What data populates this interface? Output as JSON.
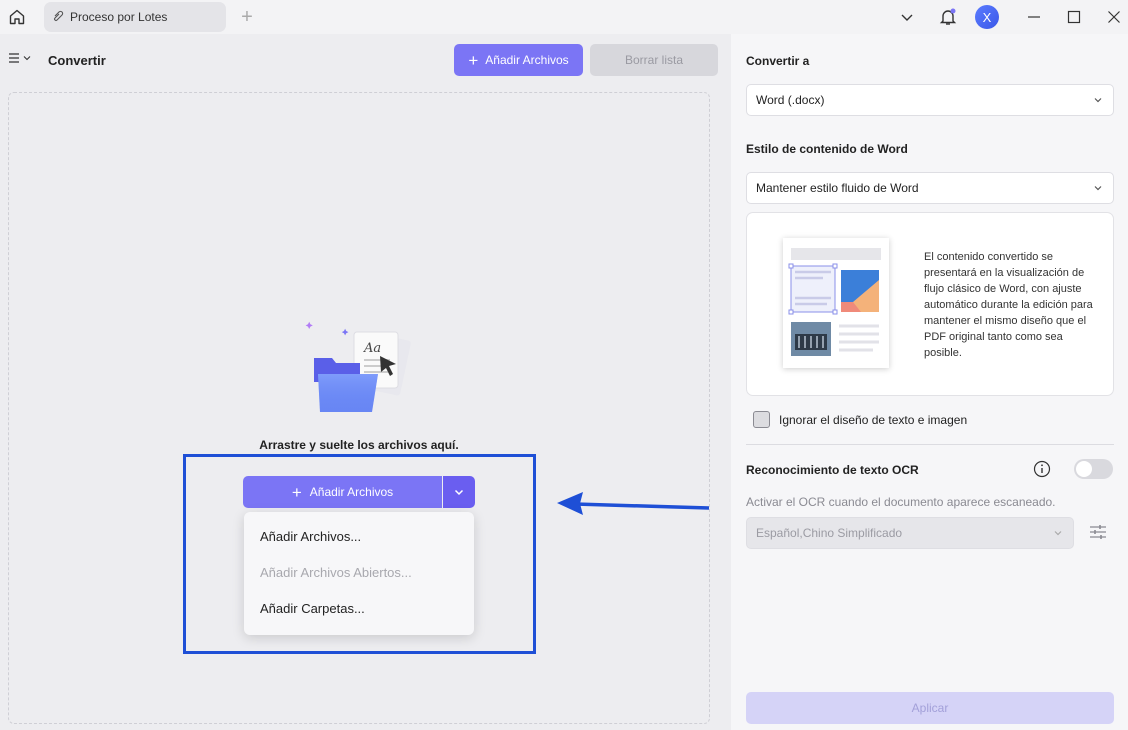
{
  "titlebar": {
    "tab_label": "Proceso por Lotes",
    "avatar_initial": "X",
    "icons": [
      "home-icon",
      "tab-icon",
      "plus-icon",
      "chevron-down-icon",
      "bell-icon",
      "minimize-icon",
      "maximize-icon",
      "close-icon"
    ]
  },
  "left": {
    "title": "Convertir",
    "add_files_label": "Añadir Archivos",
    "clear_list_label": "Borrar lista",
    "drop_text": "Arrastre y suelte los archivos aquí.",
    "add_button_label": "Añadir Archivos",
    "dropdown_items": [
      {
        "label": "Añadir Archivos...",
        "enabled": true
      },
      {
        "label": "Añadir Archivos Abiertos...",
        "enabled": false
      },
      {
        "label": "Añadir Carpetas...",
        "enabled": true
      }
    ]
  },
  "right": {
    "convert_to_label": "Convertir a",
    "format_value": "Word (.docx)",
    "style_label": "Estilo de contenido de Word",
    "style_value": "Mantener estilo fluido de Word",
    "preview_description": "El contenido convertido se presentará en la visualización de flujo clásico de Word, con ajuste automático durante la edición para mantener el mismo diseño que el PDF original tanto como sea posible.",
    "ignore_layout_label": "Ignorar el diseño de texto e imagen",
    "ignore_layout_checked": false,
    "ocr_label": "Reconocimiento de texto OCR",
    "ocr_enabled": false,
    "ocr_description": "Activar el OCR cuando el documento aparece escaneado.",
    "ocr_language": "Español,Chino Simplificado",
    "apply_label": "Aplicar"
  },
  "colors": {
    "accent": "#7b75f5",
    "accent_dark": "#6a5ef0",
    "highlight": "#1e4fd6"
  }
}
